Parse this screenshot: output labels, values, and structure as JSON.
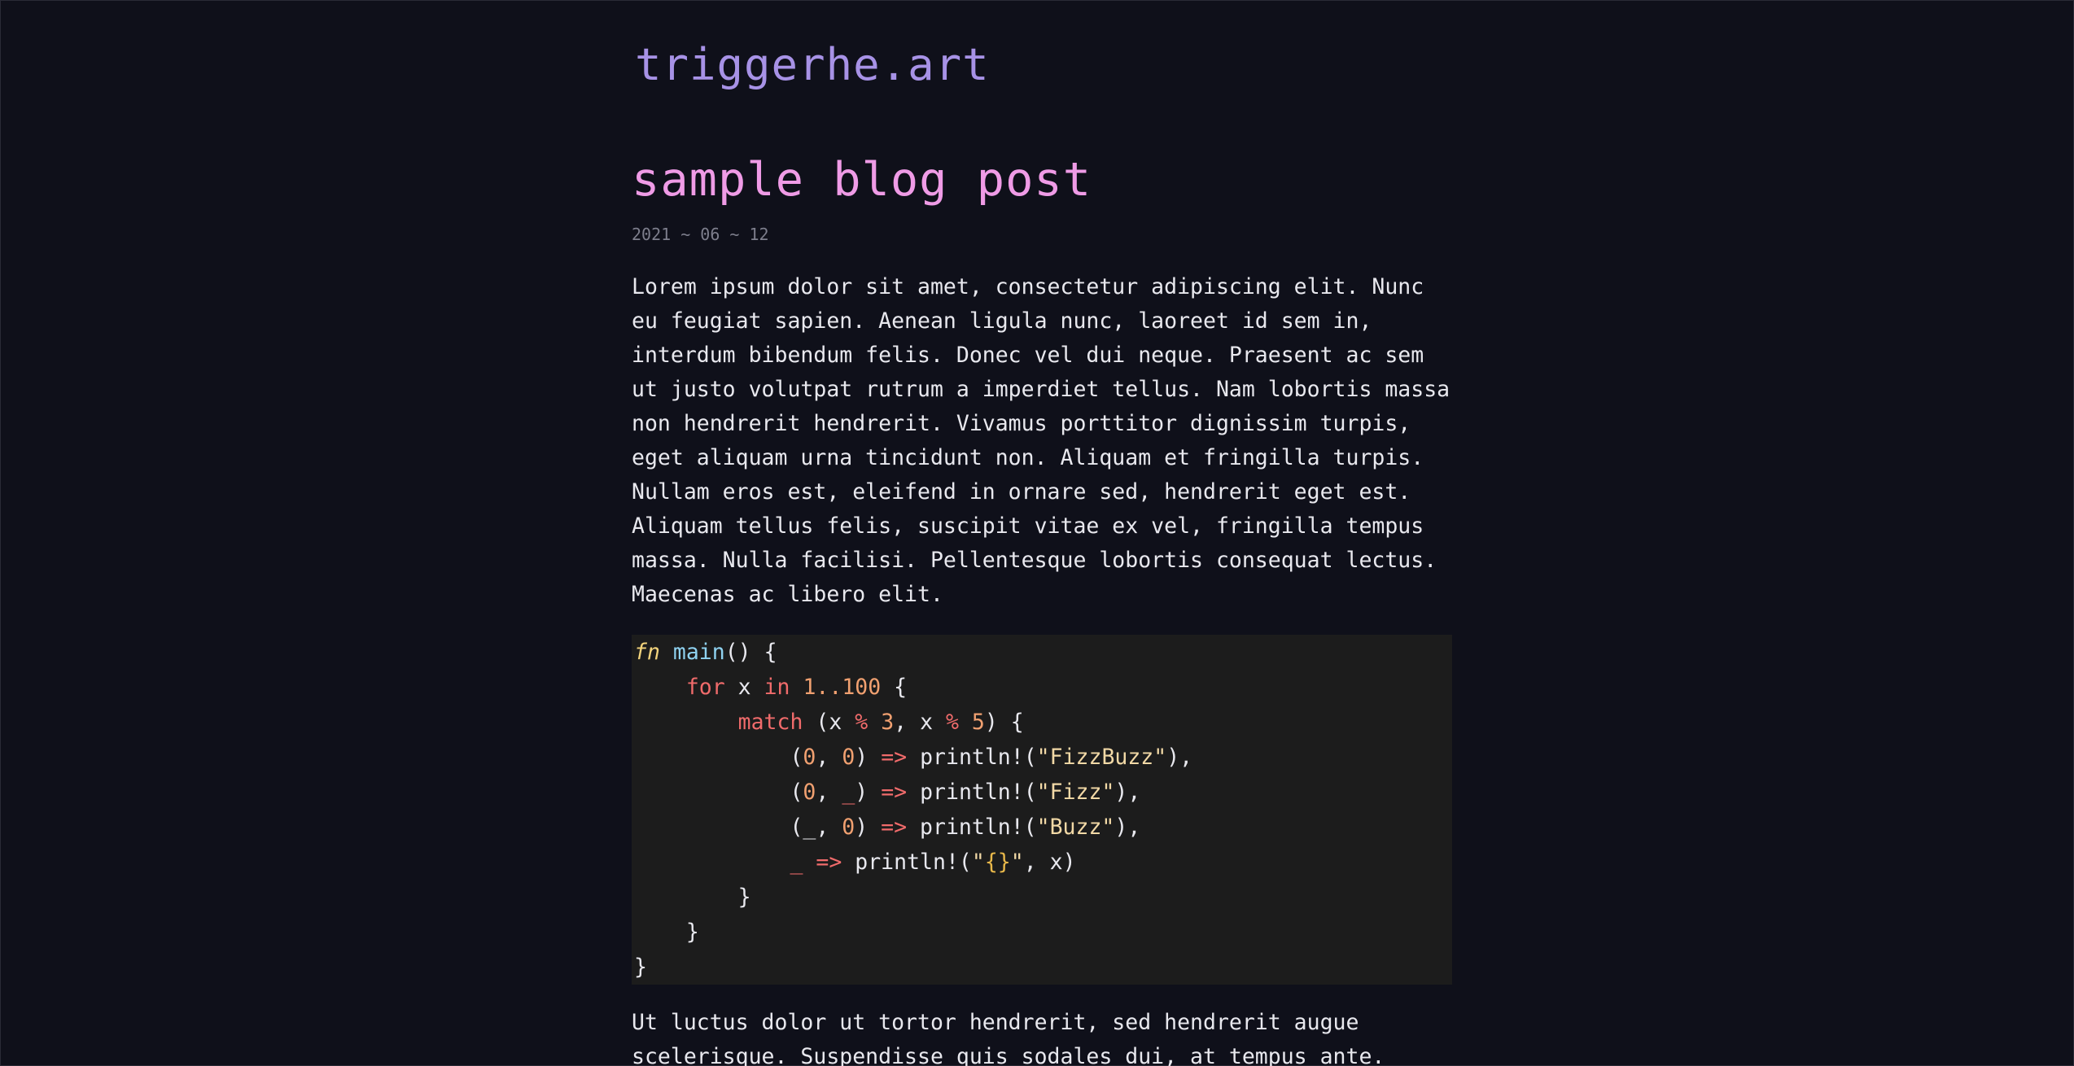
{
  "site": {
    "title": "triggerhe.art"
  },
  "post": {
    "title": "sample blog post",
    "date": "2021 ~ 06 ~ 12",
    "paragraph_1_lines": [
      "Lorem ipsum dolor sit amet, consectetur adipiscing elit. Nunc",
      "eu feugiat sapien. Aenean ligula nunc, laoreet id sem in,",
      "interdum bibendum felis. Donec vel dui neque. Praesent ac sem",
      "ut justo volutpat rutrum a imperdiet tellus. Nam lobortis massa",
      "non hendrerit hendrerit. Vivamus porttitor dignissim turpis,",
      "eget aliquam urna tincidunt non. Aliquam et fringilla turpis.",
      "Nullam eros est, eleifend in ornare sed, hendrerit eget est.",
      "Aliquam tellus felis, suscipit vitae ex vel, fringilla tempus",
      "massa. Nulla facilisi. Pellentesque lobortis consequat lectus.",
      "Maecenas ac libero elit."
    ],
    "paragraph_2_lines": [
      "Ut luctus dolor ut tortor hendrerit, sed hendrerit augue",
      "scelerisque. Suspendisse quis sodales dui, at tempus ante."
    ],
    "code": {
      "language": "rust",
      "lines": [
        [
          [
            "fn",
            "fn"
          ],
          [
            "plain",
            " "
          ],
          [
            "name",
            "main"
          ],
          [
            "plain",
            "() {"
          ]
        ],
        [
          [
            "plain",
            "    "
          ],
          [
            "kw",
            "for"
          ],
          [
            "plain",
            " x "
          ],
          [
            "kw",
            "in"
          ],
          [
            "plain",
            " "
          ],
          [
            "num",
            "1..100"
          ],
          [
            "plain",
            " {"
          ]
        ],
        [
          [
            "plain",
            "        "
          ],
          [
            "kw",
            "match"
          ],
          [
            "plain",
            " (x "
          ],
          [
            "op",
            "%"
          ],
          [
            "plain",
            " "
          ],
          [
            "num",
            "3"
          ],
          [
            "plain",
            ", x "
          ],
          [
            "op",
            "%"
          ],
          [
            "plain",
            " "
          ],
          [
            "num",
            "5"
          ],
          [
            "plain",
            ") {"
          ]
        ],
        [
          [
            "plain",
            "            ("
          ],
          [
            "num",
            "0"
          ],
          [
            "plain",
            ", "
          ],
          [
            "num",
            "0"
          ],
          [
            "plain",
            ") "
          ],
          [
            "op",
            "=>"
          ],
          [
            "plain",
            " println!("
          ],
          [
            "str",
            "\"FizzBuzz\""
          ],
          [
            "plain",
            "),"
          ]
        ],
        [
          [
            "plain",
            "            ("
          ],
          [
            "num",
            "0"
          ],
          [
            "plain",
            ", "
          ],
          [
            "op",
            "_"
          ],
          [
            "plain",
            ") "
          ],
          [
            "op",
            "=>"
          ],
          [
            "plain",
            " println!("
          ],
          [
            "str",
            "\"Fizz\""
          ],
          [
            "plain",
            "),"
          ]
        ],
        [
          [
            "plain",
            "            (_, "
          ],
          [
            "num",
            "0"
          ],
          [
            "plain",
            ") "
          ],
          [
            "op",
            "=>"
          ],
          [
            "plain",
            " println!("
          ],
          [
            "str",
            "\"Buzz\""
          ],
          [
            "plain",
            "),"
          ]
        ],
        [
          [
            "plain",
            "            "
          ],
          [
            "op",
            "_"
          ],
          [
            "plain",
            " "
          ],
          [
            "op",
            "=>"
          ],
          [
            "plain",
            " println!("
          ],
          [
            "str",
            "\""
          ],
          [
            "fmt",
            "{}"
          ],
          [
            "str",
            "\""
          ],
          [
            "plain",
            ", x)"
          ]
        ],
        [
          [
            "plain",
            "        }"
          ]
        ],
        [
          [
            "plain",
            "    }"
          ]
        ],
        [
          [
            "plain",
            "}"
          ]
        ]
      ]
    }
  },
  "colors": {
    "background": "#0f101a",
    "site_title": "#a792e6",
    "post_title": "#ef9be6",
    "date": "#7d7e8c",
    "body_text": "#e8e8ee",
    "code_background": "#1c1c1c"
  }
}
